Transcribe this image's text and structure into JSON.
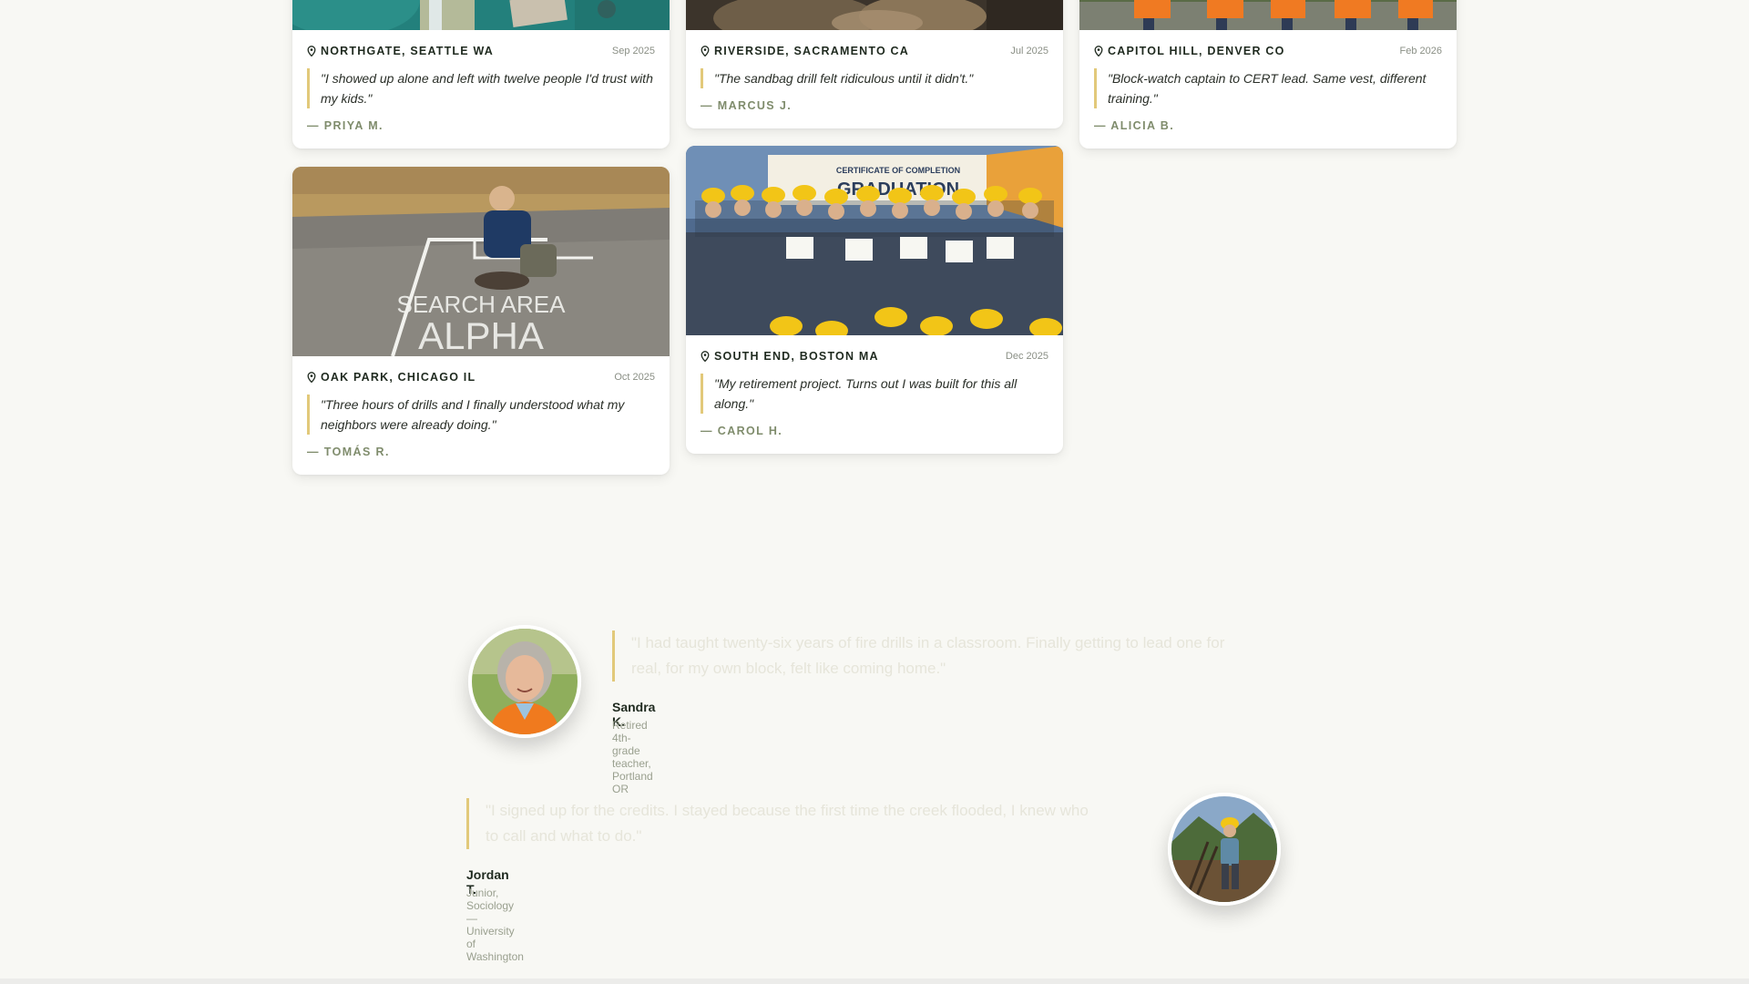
{
  "stories": [
    {
      "location": "NORTHGATE, SEATTLE WA",
      "date": "Sep 2025",
      "quote": "\"I showed up alone and left with twelve people I'd trust with my kids.\"",
      "author": "— PRIYA M."
    },
    {
      "location": "RIVERSIDE, SACRAMENTO CA",
      "date": "Jul 2025",
      "quote": "\"The sandbag drill felt ridiculous until it didn't.\"",
      "author": "— MARCUS J."
    },
    {
      "location": "CAPITOL HILL, DENVER CO",
      "date": "Feb 2026",
      "quote": "\"Block-watch captain to CERT lead. Same vest, different training.\"",
      "author": "— ALICIA B."
    },
    {
      "location": "OAK PARK, CHICAGO IL",
      "date": "Oct 2025",
      "quote": "\"Three hours of drills and I finally understood what my neighbors were already doing.\"",
      "author": "— TOMÁS R.",
      "photo_text": [
        "SEARCH AREA",
        "ALPHA"
      ]
    },
    {
      "location": "SOUTH END, BOSTON MA",
      "date": "Dec 2025",
      "quote": "\"My retirement project. Turns out I was built for this all along.\"",
      "author": "— CAROL H.",
      "photo_text": [
        "CERTIFICATE OF COMPLETION",
        "GRADUATION"
      ]
    }
  ],
  "testimonials": [
    {
      "quote": "\"I had taught twenty-six years of fire drills in a classroom. Finally getting to lead one for real, for my own block, felt like coming home.\"",
      "name": "Sandra K.",
      "role": "Retired 4th-grade teacher, Portland OR"
    },
    {
      "quote": "\"I signed up for the credits. I stayed because the first time the creek flooded, I knew who to call and what to do.\"",
      "name": "Jordan T.",
      "role": "Junior, Sociology — University of Washington"
    }
  ],
  "colors": {
    "accent": "#e2c97a",
    "author": "#7f8c6c",
    "background": "#f8f8f4"
  }
}
